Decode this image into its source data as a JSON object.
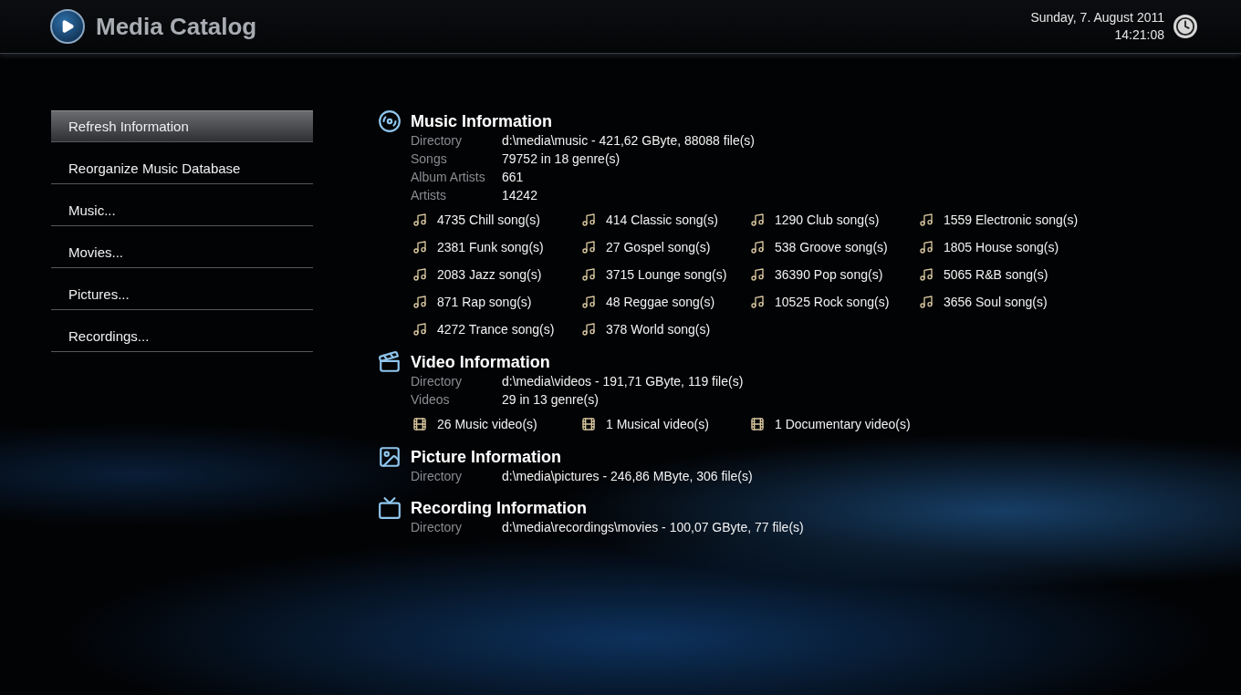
{
  "header": {
    "title": "Media Catalog",
    "date": "Sunday, 7. August 2011",
    "time": "14:21:08"
  },
  "menu": [
    {
      "label": "Refresh Information",
      "selected": true
    },
    {
      "label": "Reorganize Music Database",
      "selected": false
    },
    {
      "label": "Music...",
      "selected": false
    },
    {
      "label": "Movies...",
      "selected": false
    },
    {
      "label": "Pictures...",
      "selected": false
    },
    {
      "label": "Recordings...",
      "selected": false
    }
  ],
  "sections": [
    {
      "kind": "music",
      "title": "Music Information",
      "details": [
        {
          "label": "Directory",
          "value": "d:\\media\\music - 421,62 GByte, 88088 file(s)"
        },
        {
          "label": "Songs",
          "value": "79752 in 18 genre(s)"
        },
        {
          "label": "Album Artists",
          "value": "661"
        },
        {
          "label": "Artists",
          "value": "14242"
        }
      ],
      "items": [
        "4735 Chill song(s)",
        "414 Classic song(s)",
        "1290 Club song(s)",
        "1559 Electronic song(s)",
        "2381 Funk song(s)",
        "27 Gospel song(s)",
        "538 Groove song(s)",
        "1805 House song(s)",
        "2083 Jazz song(s)",
        "3715 Lounge song(s)",
        "36390 Pop song(s)",
        "5065 R&B song(s)",
        "871 Rap song(s)",
        "48 Reggae song(s)",
        "10525 Rock song(s)",
        "3656 Soul song(s)",
        "4272 Trance song(s)",
        "378 World song(s)"
      ]
    },
    {
      "kind": "video",
      "title": "Video Information",
      "details": [
        {
          "label": "Directory",
          "value": "d:\\media\\videos - 191,71 GByte, 119 file(s)"
        },
        {
          "label": "Videos",
          "value": "29 in 13 genre(s)"
        }
      ],
      "items": [
        "26 Music video(s)",
        "1 Musical video(s)",
        "1 Documentary video(s)"
      ]
    },
    {
      "kind": "picture",
      "title": "Picture Information",
      "details": [
        {
          "label": "Directory",
          "value": "d:\\media\\pictures - 246,86 MByte, 306 file(s)"
        }
      ]
    },
    {
      "kind": "recording",
      "title": "Recording Information",
      "details": [
        {
          "label": "Directory",
          "value": "d:\\media\\recordings\\movies - 100,07 GByte, 77 file(s)"
        }
      ]
    }
  ]
}
